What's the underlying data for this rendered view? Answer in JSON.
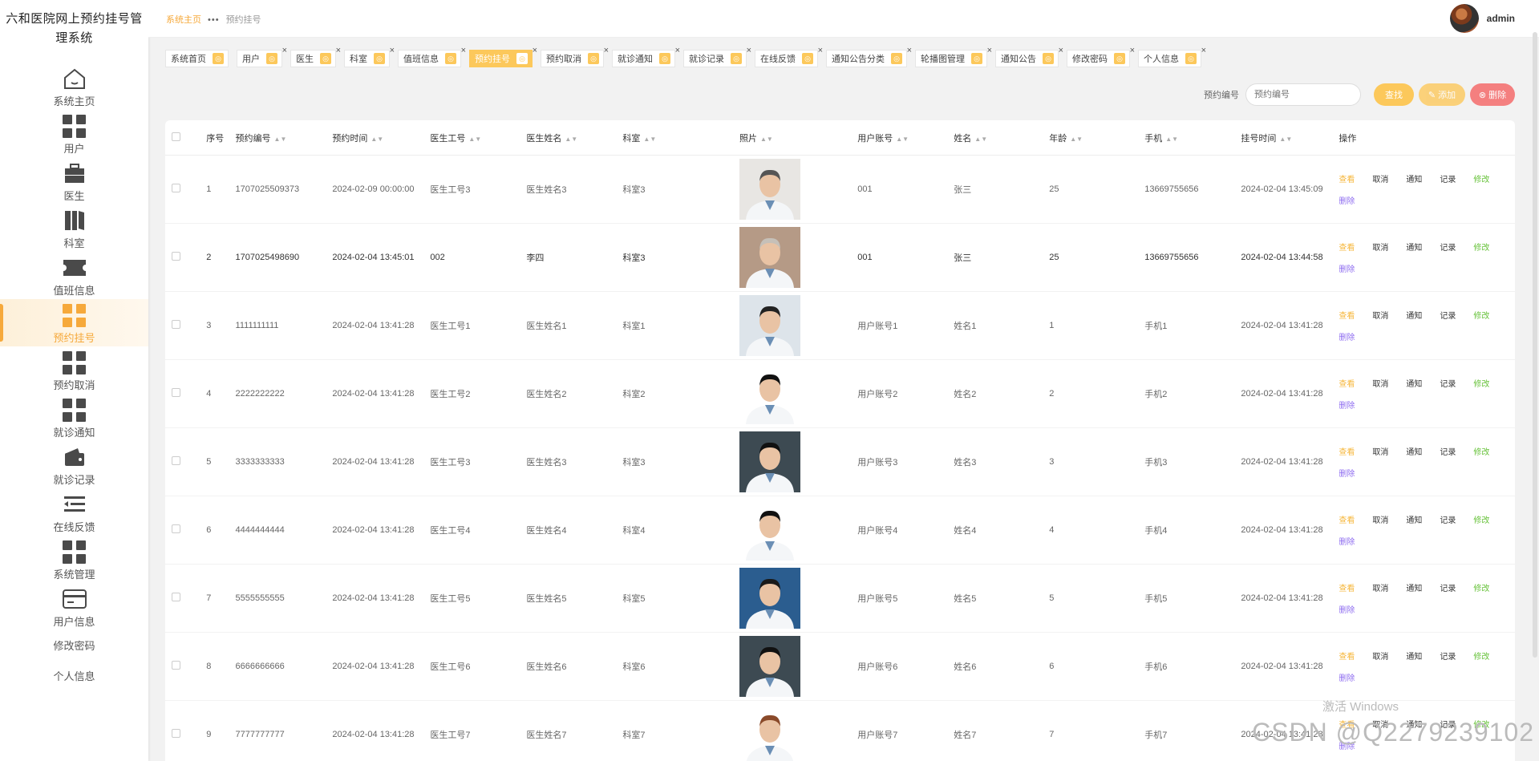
{
  "app": {
    "title": "六和医院网上预约挂号管理系统"
  },
  "sidebar": {
    "items": [
      {
        "label": "系统主页",
        "icon": "home-icon"
      },
      {
        "label": "用户",
        "icon": "grid-icon"
      },
      {
        "label": "医生",
        "icon": "briefcase-icon"
      },
      {
        "label": "科室",
        "icon": "books-icon"
      },
      {
        "label": "值班信息",
        "icon": "ticket-icon"
      },
      {
        "label": "预约挂号",
        "icon": "grid-icon",
        "active": true
      },
      {
        "label": "预约取消",
        "icon": "grid-icon"
      },
      {
        "label": "就诊通知",
        "icon": "grid-icon"
      },
      {
        "label": "就诊记录",
        "icon": "wallet-icon"
      },
      {
        "label": "在线反馈",
        "icon": "list-icon"
      },
      {
        "label": "系统管理",
        "icon": "grid-icon"
      },
      {
        "label": "用户信息",
        "icon": "card-icon"
      },
      {
        "label": "修改密码"
      },
      {
        "label": "个人信息"
      }
    ]
  },
  "header": {
    "breadcrumb_home": "系统主页",
    "breadcrumb_current": "预约挂号",
    "user": "admin"
  },
  "tabs": [
    {
      "label": "系统首页"
    },
    {
      "label": "用户"
    },
    {
      "label": "医生"
    },
    {
      "label": "科室"
    },
    {
      "label": "值班信息"
    },
    {
      "label": "预约挂号",
      "active": true
    },
    {
      "label": "预约取消"
    },
    {
      "label": "就诊通知"
    },
    {
      "label": "就诊记录"
    },
    {
      "label": "在线反馈"
    },
    {
      "label": "通知公告分类"
    },
    {
      "label": "轮播图管理"
    },
    {
      "label": "通知公告"
    },
    {
      "label": "修改密码"
    },
    {
      "label": "个人信息"
    }
  ],
  "search": {
    "label": "预约编号",
    "placeholder": "预约编号",
    "find_label": "查找",
    "add_label": "添加",
    "delete_label": "删除"
  },
  "table": {
    "headers": [
      "序号",
      "预约编号",
      "预约时间",
      "医生工号",
      "医生姓名",
      "科室",
      "照片",
      "用户账号",
      "姓名",
      "年龄",
      "手机",
      "挂号时间",
      "操作"
    ],
    "actions": {
      "view": "查看",
      "cancel": "取消",
      "notify": "通知",
      "record": "记录",
      "edit": "修改",
      "delete": "删除"
    },
    "rows": [
      [
        "1",
        "1707025509373",
        "2024-02-09 00:00:00",
        "医生工号3",
        "医生姓名3",
        "科室3",
        "001",
        "张三",
        "25",
        "13669755656",
        "2024-02-04 13:45:09"
      ],
      [
        "2",
        "1707025498690",
        "2024-02-04 13:45:01",
        "002",
        "李四",
        "科室3",
        "001",
        "张三",
        "25",
        "13669755656",
        "2024-02-04 13:44:58"
      ],
      [
        "3",
        "1111111111",
        "2024-02-04 13:41:28",
        "医生工号1",
        "医生姓名1",
        "科室1",
        "用户账号1",
        "姓名1",
        "1",
        "手机1",
        "2024-02-04 13:41:28"
      ],
      [
        "4",
        "2222222222",
        "2024-02-04 13:41:28",
        "医生工号2",
        "医生姓名2",
        "科室2",
        "用户账号2",
        "姓名2",
        "2",
        "手机2",
        "2024-02-04 13:41:28"
      ],
      [
        "5",
        "3333333333",
        "2024-02-04 13:41:28",
        "医生工号3",
        "医生姓名3",
        "科室3",
        "用户账号3",
        "姓名3",
        "3",
        "手机3",
        "2024-02-04 13:41:28"
      ],
      [
        "6",
        "4444444444",
        "2024-02-04 13:41:28",
        "医生工号4",
        "医生姓名4",
        "科室4",
        "用户账号4",
        "姓名4",
        "4",
        "手机4",
        "2024-02-04 13:41:28"
      ],
      [
        "7",
        "5555555555",
        "2024-02-04 13:41:28",
        "医生工号5",
        "医生姓名5",
        "科室5",
        "用户账号5",
        "姓名5",
        "5",
        "手机5",
        "2024-02-04 13:41:28"
      ],
      [
        "8",
        "6666666666",
        "2024-02-04 13:41:28",
        "医生工号6",
        "医生姓名6",
        "科室6",
        "用户账号6",
        "姓名6",
        "6",
        "手机6",
        "2024-02-04 13:41:28"
      ],
      [
        "9",
        "7777777777",
        "2024-02-04 13:41:28",
        "医生工号7",
        "医生姓名7",
        "科室7",
        "用户账号7",
        "姓名7",
        "7",
        "手机7",
        "2024-02-04 13:41:28"
      ]
    ]
  },
  "watermark": {
    "windows": "激活 Windows",
    "csdn": "CSDN @Q2279239102"
  },
  "colors": {
    "accent": "#fcc85b",
    "danger": "#f56c6c",
    "edit": "#67c23a",
    "delete": "#8e6cf0"
  }
}
